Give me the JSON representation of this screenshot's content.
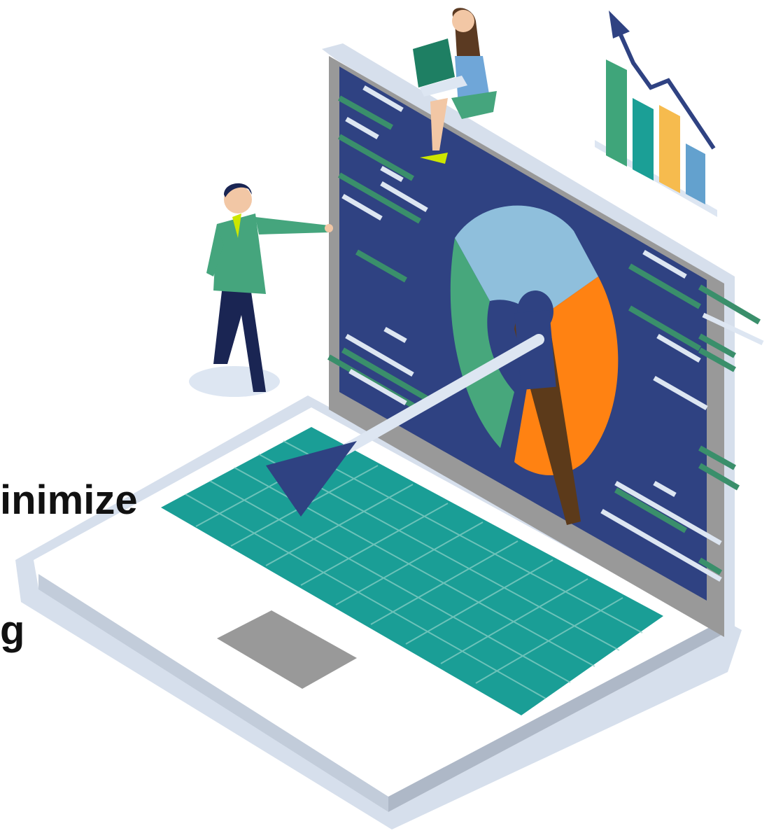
{
  "caption": {
    "line1": "inimize",
    "line2": "g"
  },
  "colors": {
    "screen": "#2F4282",
    "laptop_body": "#FFFFFF",
    "laptop_outline": "#D6DFEC",
    "keyboard": "#1A9E96",
    "trackpad": "#999999",
    "pie_light_blue": "#8FBFDC",
    "pie_green": "#47A77C",
    "pie_orange": "#FF8212",
    "bar_green": "#3FA57A",
    "bar_teal": "#1B9F96",
    "bar_yellow": "#F6BB4E",
    "bar_blue": "#63A1CE",
    "arrow": "#2F4282",
    "code_green": "#3A8F6B",
    "code_white": "#DDE6F2"
  },
  "icons": {
    "main": "laptop-analytics-illustration",
    "chart": "bar-chart-up-arrow-icon",
    "people": [
      "standing-man-figure",
      "sitting-woman-with-laptop-figure"
    ]
  }
}
